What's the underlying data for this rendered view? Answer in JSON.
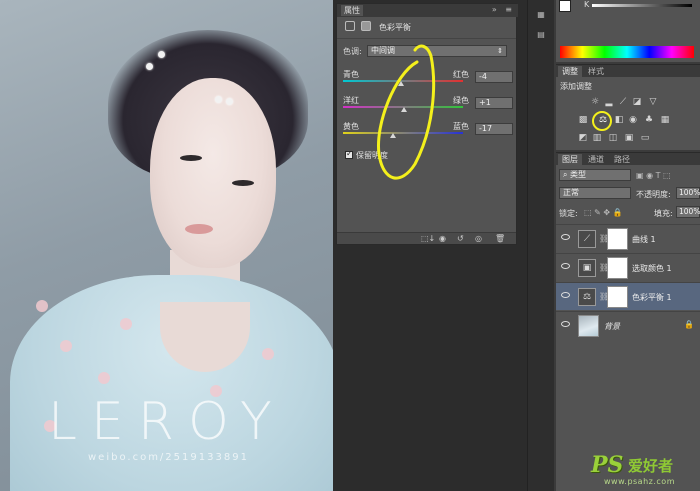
{
  "photo": {
    "watermark": "LEROY",
    "watermark_sub": "weibo.com/2519133891"
  },
  "properties_panel": {
    "tab_label": "属性",
    "panel_name": "色彩平衡",
    "tone_label": "色调:",
    "tone_value": "中间调",
    "sliders": [
      {
        "left": "青色",
        "right": "红色",
        "value": "-4",
        "position": -4,
        "gradient": [
          "#00c8d2",
          "#e23030"
        ]
      },
      {
        "left": "洋红",
        "right": "绿色",
        "value": "+1",
        "position": 1,
        "gradient": [
          "#d431c8",
          "#31c43a"
        ]
      },
      {
        "left": "黄色",
        "right": "蓝色",
        "value": "-17",
        "position": -17,
        "gradient": [
          "#e0d21a",
          "#2732d6"
        ]
      }
    ],
    "preserve_luminosity": "保留明度",
    "preserve_checked": true
  },
  "color_panel": {
    "channel_label": "K"
  },
  "adjustments_panel": {
    "tabs": [
      "调整",
      "样式"
    ],
    "active_tab": 0,
    "title": "添加调整"
  },
  "layers_panel": {
    "tabs": [
      "图层",
      "通道",
      "路径"
    ],
    "active_tab": 0,
    "filter_type": "类型",
    "blend_mode": "正常",
    "opacity_label": "不透明度:",
    "opacity_value": "100%",
    "lock_label": "锁定:",
    "fill_label": "填充:",
    "fill_value": "100%",
    "layers": [
      {
        "name": "曲线 1",
        "icon": "curves-icon",
        "selected": false
      },
      {
        "name": "选取颜色 1",
        "icon": "selective-color-icon",
        "selected": false
      },
      {
        "name": "色彩平衡 1",
        "icon": "color-balance-icon",
        "selected": true
      },
      {
        "name": "背景",
        "icon": "image-thumb",
        "selected": false
      }
    ]
  },
  "site_watermark": {
    "logo": "PS",
    "cn": "爱好者",
    "url": "www.psahz.com"
  },
  "colors": {
    "accent_selected_layer": "#58677f",
    "annotation_yellow": "#f4f01c",
    "panel": "#535353"
  }
}
